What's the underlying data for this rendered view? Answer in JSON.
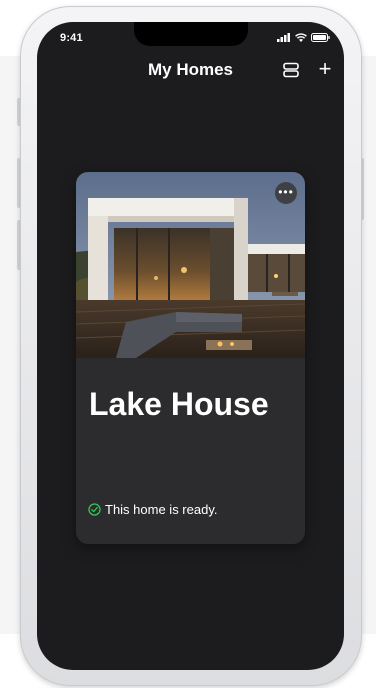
{
  "status_bar": {
    "time": "9:41",
    "icons": [
      "cellular-icon",
      "wifi-icon",
      "battery-icon"
    ]
  },
  "nav": {
    "title": "My Homes",
    "list_icon": "list-icon",
    "add_icon": "plus-icon",
    "add_glyph": "+"
  },
  "home_card": {
    "name": "Lake House",
    "more_glyph": "•••",
    "status_icon": "check-circle-icon",
    "status_color": "#34c759",
    "status_text": "This home is ready."
  }
}
